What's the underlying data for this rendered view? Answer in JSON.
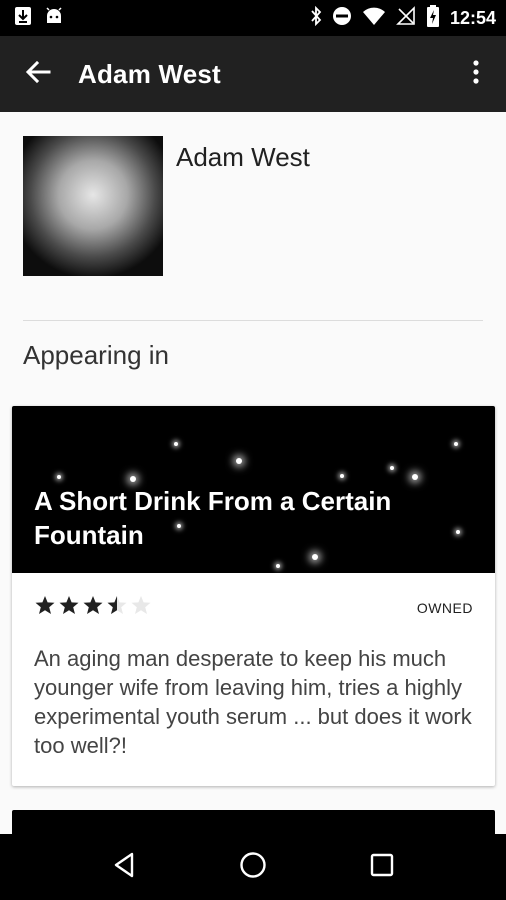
{
  "status_bar": {
    "time": "12:54",
    "left_icons": [
      "download-icon",
      "android-icon"
    ],
    "right_icons": [
      "bluetooth-icon",
      "do-not-disturb-icon",
      "wifi-icon",
      "no-signal-icon",
      "battery-charging-icon"
    ]
  },
  "app_bar": {
    "title": "Adam West",
    "back_icon": "arrow-back-icon",
    "menu_icon": "more-vert-icon"
  },
  "profile": {
    "name": "Adam West"
  },
  "section": {
    "title": "Appearing in"
  },
  "cards": [
    {
      "title": "A Short Drink From a Certain Fountain",
      "rating": 3.5,
      "rating_max": 5,
      "status": "OWNED",
      "description": "An aging man desperate to keep his much younger wife from leaving him, tries a highly experimental youth serum ... but does it work too well?!"
    }
  ],
  "nav_bar": {
    "icons": [
      "back-triangle-icon",
      "home-circle-icon",
      "recents-square-icon"
    ]
  },
  "colors": {
    "app_bar_bg": "#212121",
    "status_bar_bg": "#000000",
    "page_bg": "#fafafa",
    "card_hero_bg": "#000000"
  }
}
